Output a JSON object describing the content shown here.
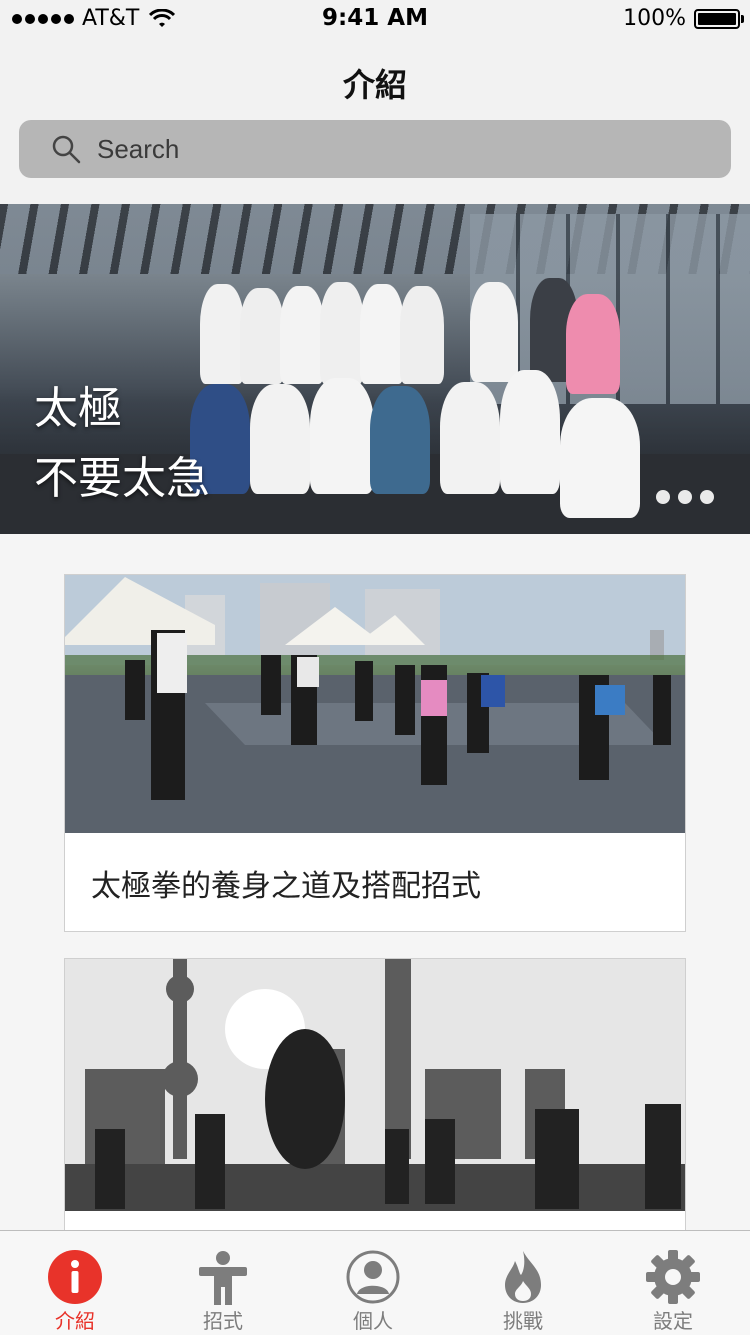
{
  "status_bar": {
    "carrier": "AT&T",
    "time": "9:41 AM",
    "battery": "100%",
    "battery_level": 1.0
  },
  "nav": {
    "title": "介紹"
  },
  "search": {
    "placeholder": "Search"
  },
  "hero": {
    "line1": "太極",
    "line2": "不要太急",
    "page_count": 3
  },
  "cards": [
    {
      "title": "太極拳的養身之道及搭配招式"
    },
    {
      "title": ""
    }
  ],
  "tabbar": {
    "active_color": "#e8332a",
    "inactive_color": "#7d7d7d",
    "tabs": [
      {
        "label": "介紹",
        "icon": "info-icon",
        "active": true
      },
      {
        "label": "招式",
        "icon": "person-icon",
        "active": false
      },
      {
        "label": "個人",
        "icon": "profile-icon",
        "active": false
      },
      {
        "label": "挑戰",
        "icon": "fire-icon",
        "active": false
      },
      {
        "label": "設定",
        "icon": "gear-icon",
        "active": false
      }
    ]
  }
}
